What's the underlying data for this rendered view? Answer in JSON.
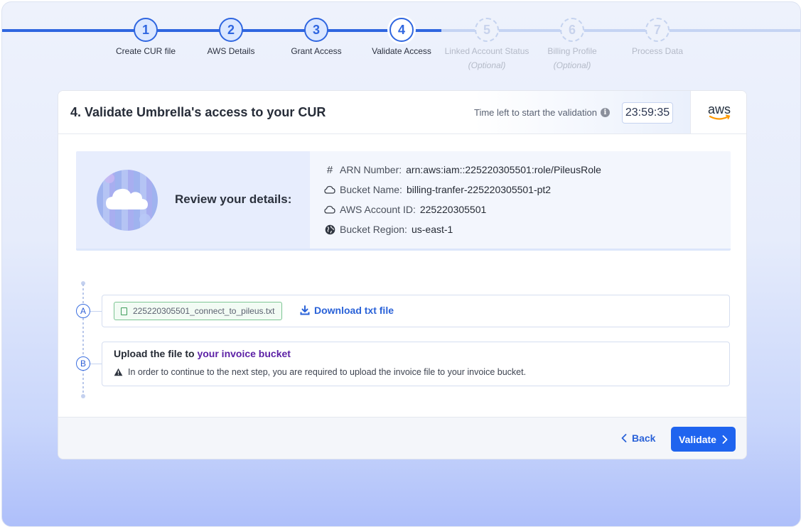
{
  "stepper": {
    "steps": [
      {
        "number": "1",
        "label": "Create CUR file",
        "optional": "",
        "state": "done"
      },
      {
        "number": "2",
        "label": "AWS Details",
        "optional": "",
        "state": "done"
      },
      {
        "number": "3",
        "label": "Grant Access",
        "optional": "",
        "state": "done"
      },
      {
        "number": "4",
        "label": "Validate Access",
        "optional": "",
        "state": "current"
      },
      {
        "number": "5",
        "label": "Linked Account Status",
        "optional": "(Optional)",
        "state": "todo"
      },
      {
        "number": "6",
        "label": "Billing Profile",
        "optional": "(Optional)",
        "state": "todo"
      },
      {
        "number": "7",
        "label": "Process Data",
        "optional": "",
        "state": "todo"
      }
    ]
  },
  "card": {
    "title": "4. Validate Umbrella's access to your CUR",
    "timer_label": "Time left to start the validation",
    "timer_value": "23:59:35",
    "logo_text": "aws"
  },
  "review": {
    "title": "Review your details:",
    "details": [
      {
        "icon": "hash-icon",
        "label": "ARN Number:",
        "value": "arn:aws:iam::225220305501:role/PileusRole"
      },
      {
        "icon": "cloud-icon",
        "label": "Bucket Name:",
        "value": "billing-tranfer-225220305501-pt2"
      },
      {
        "icon": "cloud-icon",
        "label": "AWS Account ID:",
        "value": "225220305501"
      },
      {
        "icon": "globe-icon",
        "label": "Bucket Region:",
        "value": "us-east-1"
      }
    ]
  },
  "step_a": {
    "badge": "A",
    "file_name": "225220305501_connect_to_pileus.txt",
    "download_label": "Download txt file"
  },
  "step_b": {
    "badge": "B",
    "title_prefix": "Upload the file to",
    "title_link": "your invoice bucket",
    "warning": "In order to continue to the next step, you are required to upload the invoice file to your invoice bucket."
  },
  "footer": {
    "back_label": "Back",
    "validate_label": "Validate"
  },
  "colors": {
    "primary": "#1f64ef",
    "link_purple": "#5b1fa5",
    "file_green": "#3f9d5b"
  }
}
